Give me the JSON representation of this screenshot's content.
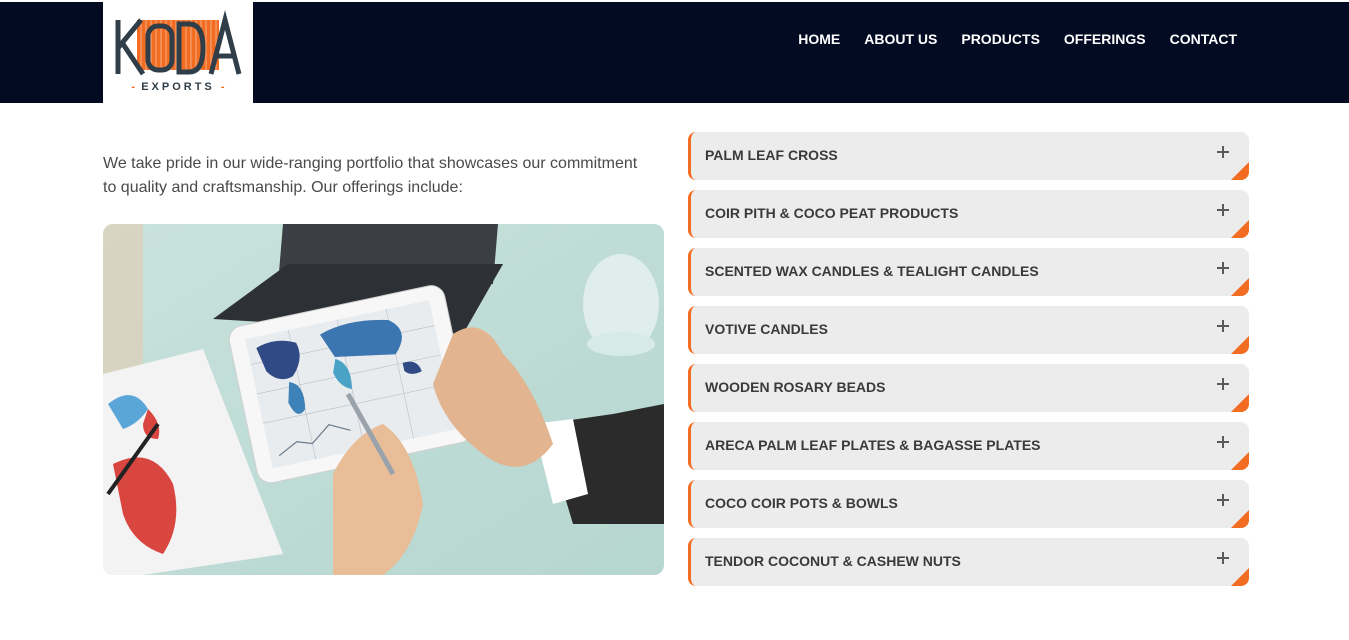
{
  "header": {
    "logo": {
      "wordmark": "KODA",
      "subtitle": "EXPORTS"
    },
    "nav": [
      {
        "label": "HOME"
      },
      {
        "label": "ABOUT US"
      },
      {
        "label": "PRODUCTS"
      },
      {
        "label": "OFFERINGS"
      },
      {
        "label": "CONTACT"
      }
    ]
  },
  "main": {
    "intro": "We take pride in our wide-ranging portfolio that showcases our commitment to quality and craftsmanship. Our offerings include:",
    "offerings": [
      {
        "label": "PALM LEAF CROSS",
        "icon": "plus-icon"
      },
      {
        "label": "COIR PITH & COCO PEAT PRODUCTS",
        "icon": "plus-icon"
      },
      {
        "label": "SCENTED WAX CANDLES & TEALIGHT CANDLES",
        "icon": "plus-icon"
      },
      {
        "label": "VOTIVE CANDLES",
        "icon": "plus-icon"
      },
      {
        "label": "WOODEN ROSARY BEADS",
        "icon": "plus-icon"
      },
      {
        "label": "ARECA PALM LEAF PLATES & BAGASSE PLATES",
        "icon": "plus-icon"
      },
      {
        "label": "COCO COIR POTS & BOWLS",
        "icon": "plus-icon"
      },
      {
        "label": "TENDOR COCONUT & CASHEW NUTS",
        "icon": "plus-icon"
      }
    ]
  },
  "colors": {
    "header_bg": "#020b22",
    "accent": "#f26c21",
    "item_bg": "#ececec",
    "logo_dark": "#2f3e48"
  }
}
